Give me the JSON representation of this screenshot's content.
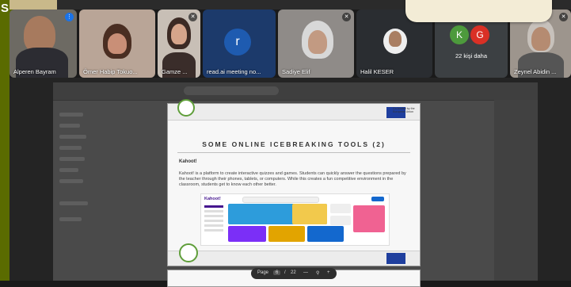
{
  "left_rail": {
    "glyph": "S"
  },
  "participants": [
    {
      "name": "Alperen Bayram",
      "mic_active": true
    },
    {
      "name": "Ömer Habip Tokuo...",
      "mic_active": false
    },
    {
      "name": "Gamze ...",
      "mic_active": false
    },
    {
      "name": "read.ai meeting no...",
      "avatar_letter": "r",
      "avatar_color": "#1e5bb0"
    },
    {
      "name": "Sadiye Elif",
      "mic_active": false
    },
    {
      "name": "Halil KESER",
      "mic_active": false
    },
    {
      "name": "Zeynel Abidin ...",
      "mic_active": false
    }
  ],
  "more_tile": {
    "letters": [
      "K",
      "G"
    ],
    "colors": [
      "#4d9a3c",
      "#d93025"
    ],
    "label": "22 kişi daha"
  },
  "shared_screen": {
    "slide": {
      "title": "SOME ONLINE ICEBREAKING TOOLS (2)",
      "heading": "Kahoot!",
      "body": "Kahoot! is a platform to create interactive quizzes and games. Students can quickly answer the questions prepared by the teacher through their phones, tablets, or computers. While this creates a fun competitive environment in the classroom, students get to know each other better.",
      "eu_label": "Co-funded by the European Union",
      "kahoot_logo": "Kahoot!"
    },
    "pager": {
      "page_label": "Page",
      "current": "6",
      "separator": "/",
      "total": "22",
      "minus": "—",
      "plus": "+"
    }
  }
}
